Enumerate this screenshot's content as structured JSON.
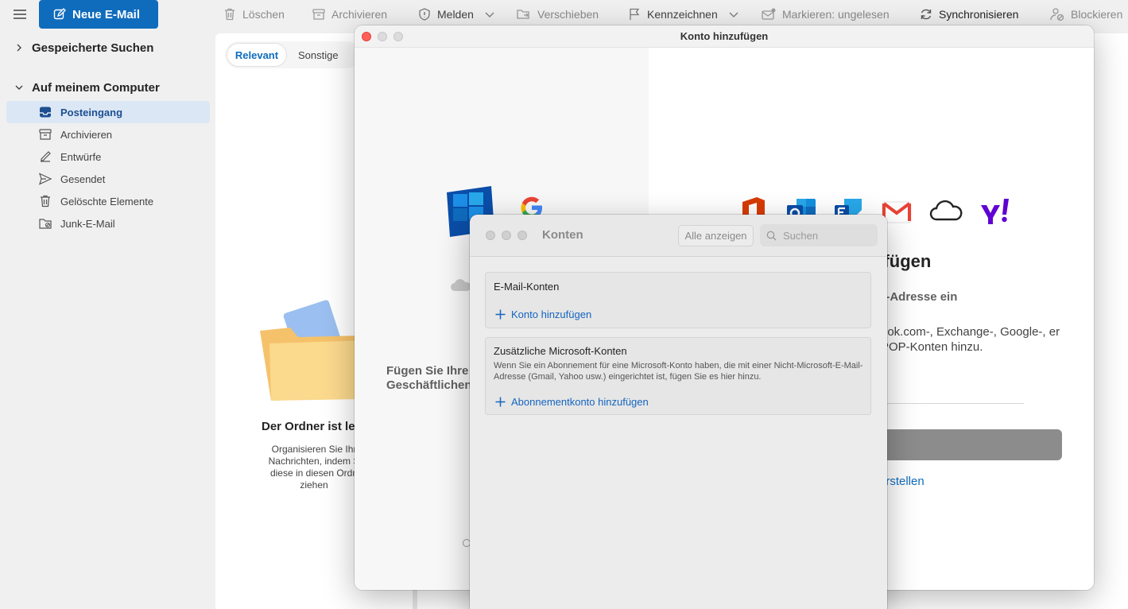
{
  "toolbar": {
    "new_mail": "Neue E-Mail",
    "delete": "Löschen",
    "archive": "Archivieren",
    "report": "Melden",
    "move": "Verschieben",
    "flag": "Kennzeichnen",
    "mark_unread": "Markieren: ungelesen",
    "sync": "Synchronisieren",
    "block": "Blockieren"
  },
  "sidebar": {
    "saved_searches": "Gespeicherte Suchen",
    "on_my_computer": "Auf meinem Computer",
    "folders": [
      {
        "label": "Posteingang",
        "icon": "inbox-icon"
      },
      {
        "label": "Archivieren",
        "icon": "archive-icon"
      },
      {
        "label": "Entwürfe",
        "icon": "draft-icon"
      },
      {
        "label": "Gesendet",
        "icon": "sent-icon"
      },
      {
        "label": "Gelöschte Elemente",
        "icon": "trash-icon"
      },
      {
        "label": "Junk-E-Mail",
        "icon": "junk-icon"
      }
    ]
  },
  "list": {
    "tab_relevant": "Relevant",
    "tab_other": "Sonstige",
    "empty_title": "Der Ordner ist le",
    "empty_desc": "Organisieren Sie Ihr Nachrichten, indem S diese in diesen Ordn ziehen"
  },
  "add_account": {
    "title": "Konto hinzufügen",
    "left_text": "Fügen Sie Ihre Yahoo-, iCloud Geschäftlichen",
    "heading": "ufügen",
    "instruction": "il-Adresse ein",
    "description": "ook.com-, Exchange-, Google-, er POP-Konten hinzu.",
    "create_link": "erstellen",
    "providers": [
      "office-icon",
      "outlook-icon",
      "exchange-icon",
      "gmail-icon",
      "icloud-icon",
      "yahoo-icon"
    ]
  },
  "konten": {
    "title": "Konten",
    "show_all": "Alle anzeigen",
    "search_placeholder": "Suchen",
    "email_section": "E-Mail-Konten",
    "add_account": "Konto hinzufügen",
    "ms_section": "Zusätzliche Microsoft-Konten",
    "ms_desc": "Wenn Sie ein Abonnement für eine Microsoft-Konto haben, die mit einer Nicht-Microsoft-E-Mail-Adresse (Gmail, Yahoo usw.) eingerichtet ist, fügen Sie es hier hinzu.",
    "add_subscription": "Abonnementkonto hinzufügen"
  },
  "colors": {
    "accent": "#0f6cbd",
    "selected_bg": "#dbe7f5",
    "traffic_red": "#ff5f57"
  }
}
